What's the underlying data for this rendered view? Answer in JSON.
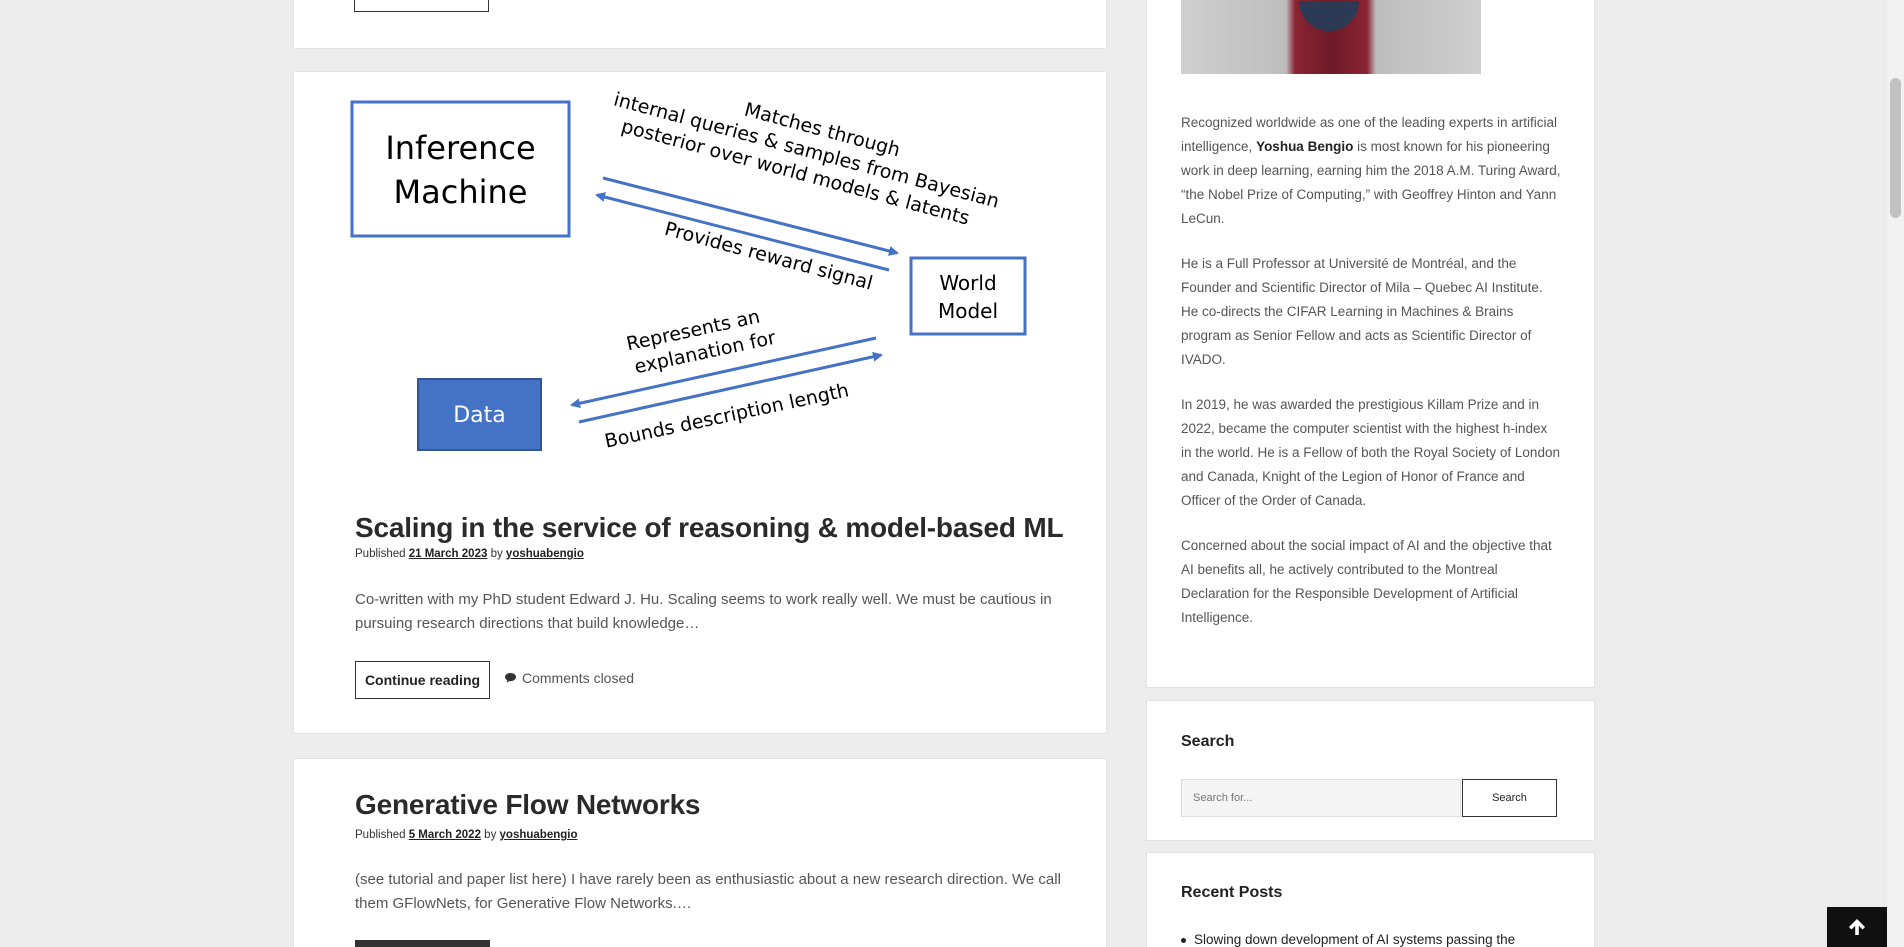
{
  "post1": {
    "diagram": {
      "inference_machine_line1": "Inference",
      "inference_machine_line2": "Machine",
      "world_model_line1": "World",
      "world_model_line2": "Model",
      "data": "Data",
      "arrow_top_line1": "Matches through",
      "arrow_top_line2": "internal queries & samples from Bayesian",
      "arrow_top_line3": "posterior over world models & latents",
      "arrow_reward": "Provides reward signal",
      "arrow_explain_line1": "Represents an",
      "arrow_explain_line2": "explanation for",
      "arrow_bounds": "Bounds description length",
      "colors": {
        "box_border": "#4472c4",
        "data_fill": "#4472c4",
        "arrow": "#4472c4"
      }
    },
    "title": "Scaling in the service of reasoning & model-based ML",
    "published_label": "Published",
    "date": "21 March 2023",
    "by_label": "by",
    "author": "yoshuabengio",
    "excerpt": "Co-written with my PhD student Edward J. Hu. Scaling seems to work really well. We must be cautious in pursuing research directions that build knowledge…",
    "continue_label": "Continue reading",
    "comments": "Comments closed",
    "comments_icon": "comment-icon"
  },
  "post2": {
    "title": "Generative Flow Networks",
    "published_label": "Published",
    "date": "5 March 2022",
    "by_label": "by",
    "author": "yoshuabengio",
    "excerpt": "(see tutorial and paper list here) I have rarely been as enthusiastic about a new research direction. We call them GFlowNets, for Generative Flow Networks.…"
  },
  "sidebar": {
    "bio_p1_before": "Recognized worldwide as one of the leading experts in artificial intelligence, ",
    "bio_p1_name": "Yoshua Bengio",
    "bio_p1_after": " is most known for his pioneering work in deep learning, earning him the 2018 A.M. Turing Award, “the Nobel Prize of Computing,” with Geoffrey Hinton and Yann LeCun.",
    "bio_p2": "He is a Full Professor at Université de Montréal, and the Founder and Scientific Director of Mila – Quebec AI Institute. He co-directs the CIFAR Learning in Machines & Brains program as Senior Fellow and acts as Scientific Director of IVADO.",
    "bio_p3": "In 2019, he was awarded the prestigious Killam Prize and in 2022, became the computer scientist with the highest h-index in the world. He is a Fellow of both the Royal Society of London and Canada, Knight of the Legion of Honor of France and Officer of the Order of Canada.",
    "bio_p4": "Concerned about the social impact of AI and the objective that AI benefits all, he actively contributed to the Montreal Declaration for the Responsible Development of Artificial Intelligence.",
    "search_title": "Search",
    "search_placeholder": "Search for...",
    "search_button": "Search",
    "recent_title": "Recent Posts",
    "recent_items": [
      "Slowing down development of AI systems passing the"
    ]
  },
  "scroll_top_icon": "arrow-up-icon"
}
